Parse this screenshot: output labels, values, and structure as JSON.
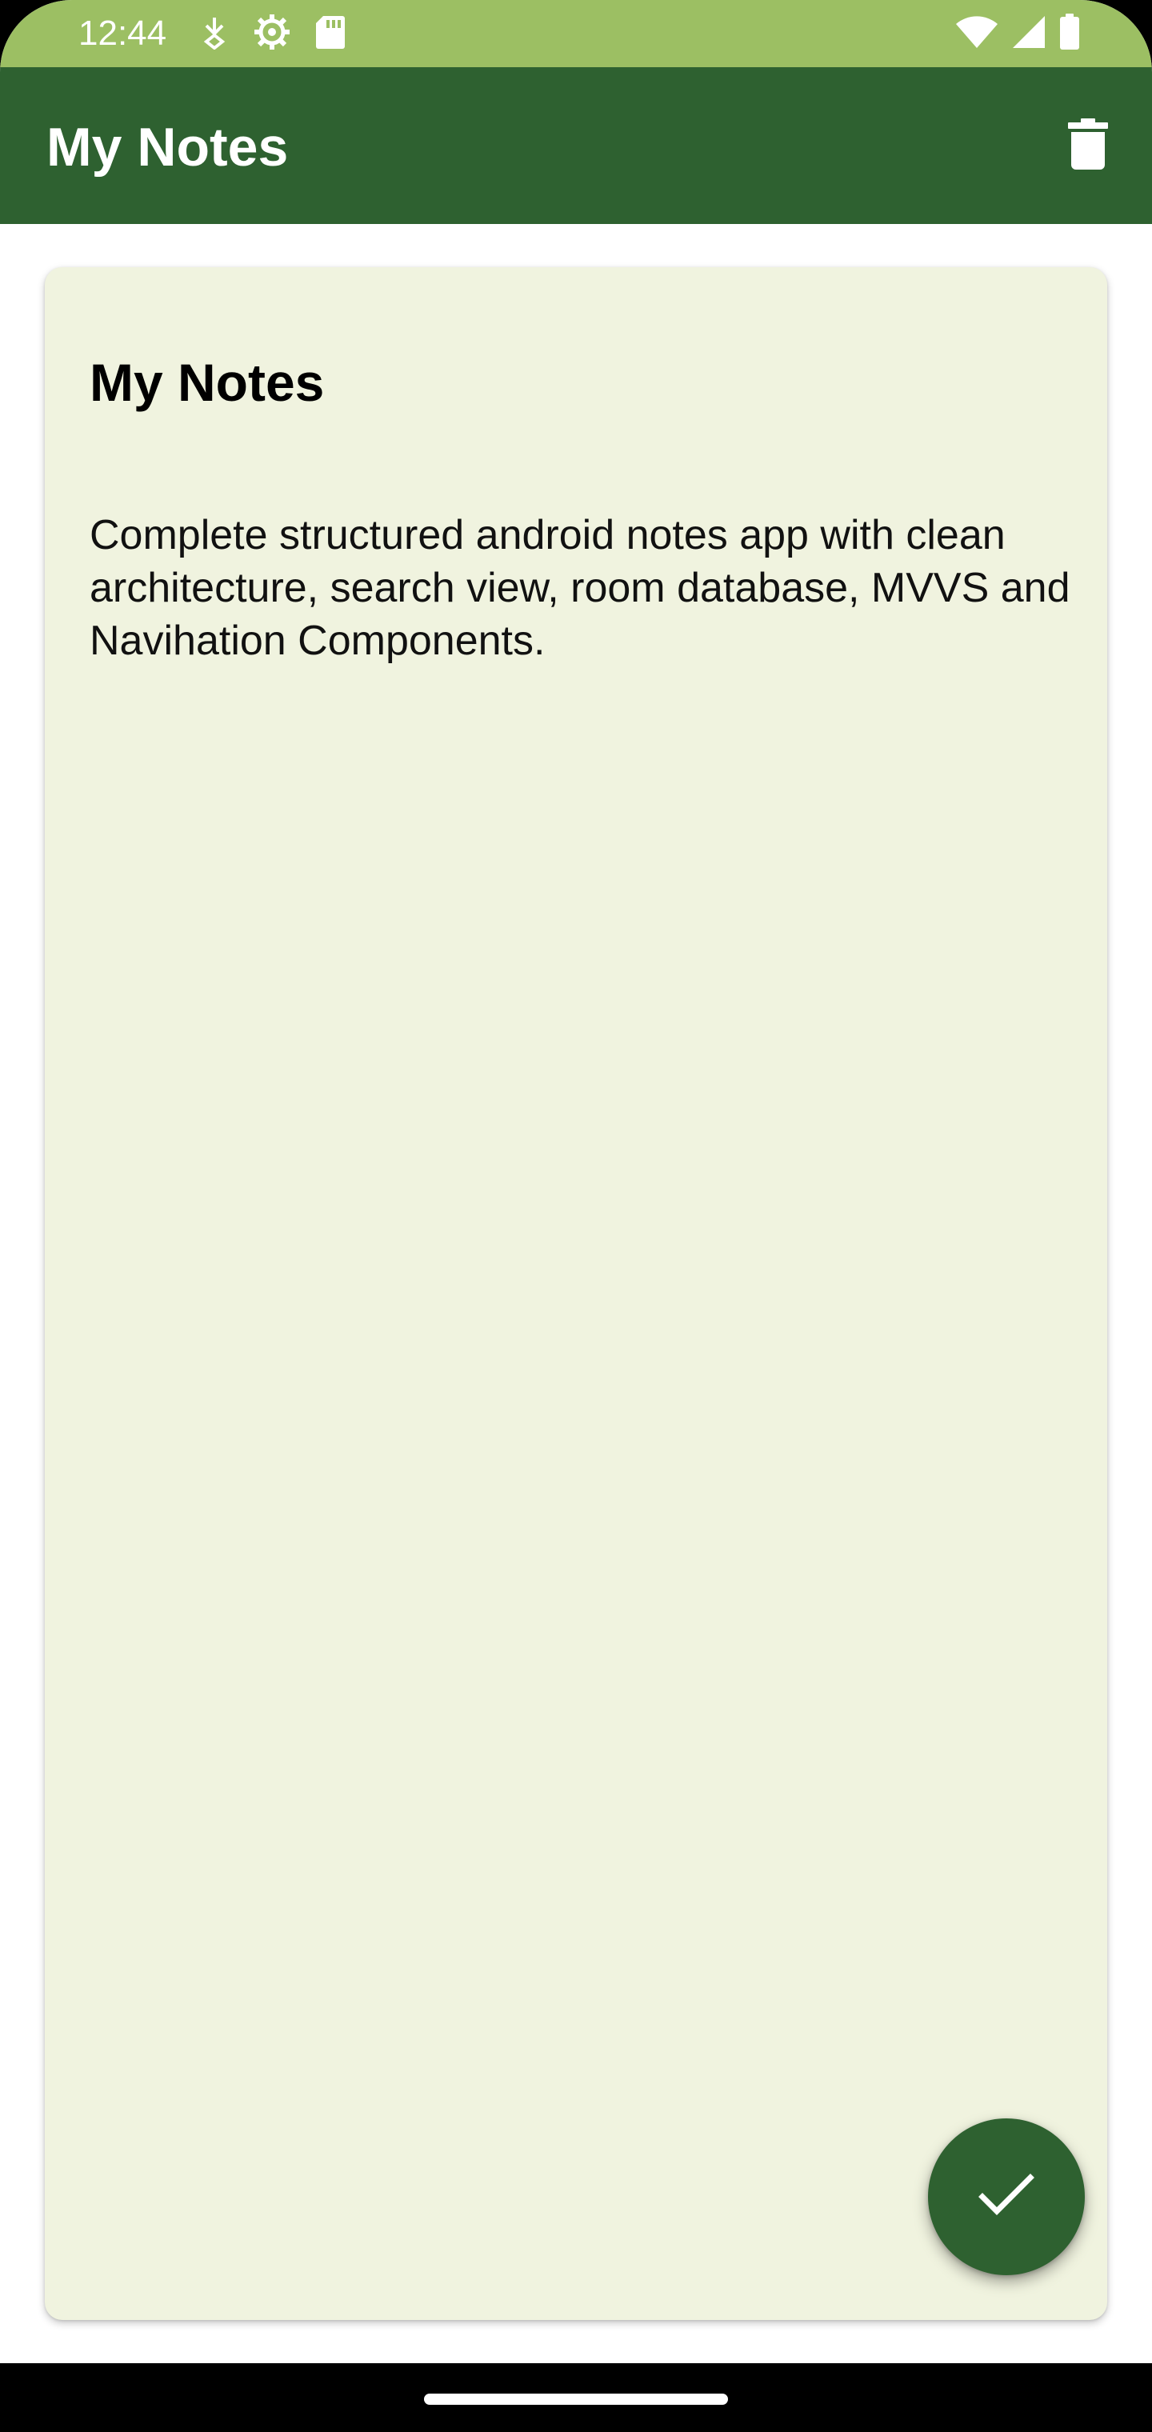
{
  "status_bar": {
    "time": "12:44",
    "left_icons": [
      "download-arrow-icon",
      "settings-gear-icon",
      "sd-card-icon"
    ],
    "right_icons": [
      "wifi-icon",
      "cellular-signal-icon",
      "battery-icon"
    ],
    "color": "#9cbf63"
  },
  "app_bar": {
    "title": "My Notes",
    "action_icon": "delete-icon",
    "color": "#2e6130"
  },
  "note": {
    "title": "My Notes",
    "body": "Complete structured android notes app with clean architecture, search view, room database, MVVS and Navihation Components.",
    "background": "#f0f3df"
  },
  "fab": {
    "icon": "check-icon",
    "color": "#2e6130"
  }
}
